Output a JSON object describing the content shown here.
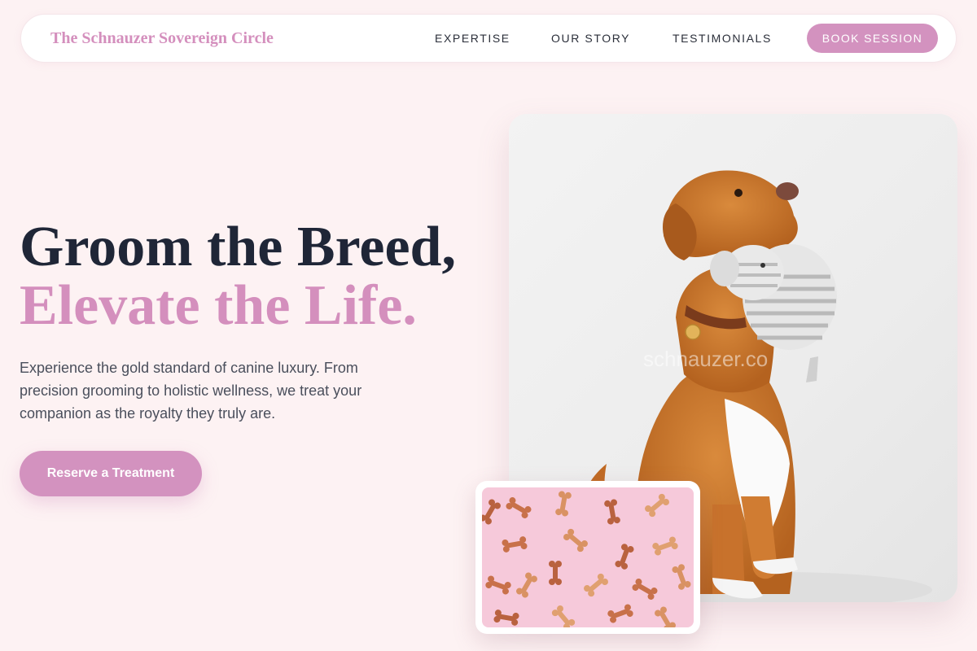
{
  "nav": {
    "brand": "The Schnauzer Sovereign Circle",
    "links": [
      "EXPERTISE",
      "OUR STORY",
      "TESTIMONIALS"
    ],
    "book_label": "BOOK SESSION"
  },
  "hero": {
    "headline_line1": "Groom the Breed,",
    "headline_line2": "Elevate the Life.",
    "description": "Experience the gold standard of canine luxury. From precision grooming to holistic wellness, we treat your companion as the royalty they truly are.",
    "cta_label": "Reserve a Treatment"
  },
  "images": {
    "main_alt": "Golden dog holding a striped plush elephant toy",
    "main_watermark": "schnauzer.co",
    "secondary_alt": "Dog bone biscuits on a pink background"
  },
  "colors": {
    "background": "#fdf2f3",
    "accent": "#d392bf",
    "heading_dark": "#1f2637"
  }
}
